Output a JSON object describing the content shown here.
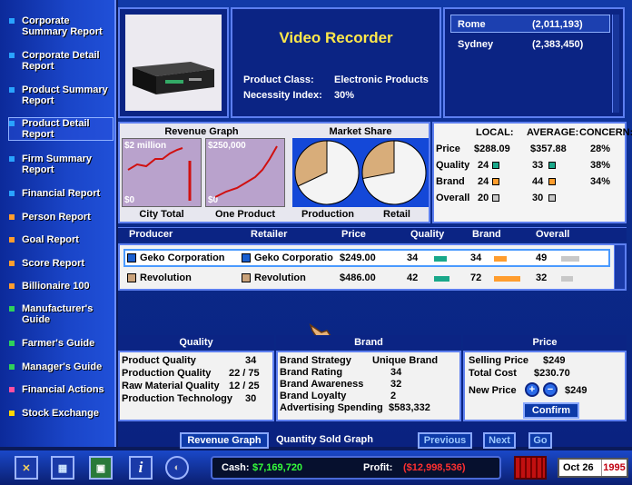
{
  "sidebar": {
    "items": [
      {
        "label": "Corporate Summary Report",
        "color": "#29a3ff"
      },
      {
        "label": "Corporate Detail Report",
        "color": "#29a3ff"
      },
      {
        "label": "Product Summary Report",
        "color": "#29a3ff"
      },
      {
        "label": "Product Detail Report",
        "color": "#29a3ff"
      },
      {
        "label": "Firm Summary Report",
        "color": "#29a3ff"
      },
      {
        "label": "Financial Report",
        "color": "#29a3ff"
      },
      {
        "label": "Person Report",
        "color": "#ff9d2e"
      },
      {
        "label": "Goal Report",
        "color": "#ff9d2e"
      },
      {
        "label": "Score Report",
        "color": "#ff9d2e"
      },
      {
        "label": "Billionaire 100",
        "color": "#ff9d2e"
      },
      {
        "label": "Manufacturer's Guide",
        "color": "#2fd15a"
      },
      {
        "label": "Farmer's Guide",
        "color": "#2fd15a"
      },
      {
        "label": "Manager's Guide",
        "color": "#2fd15a"
      },
      {
        "label": "Financial Actions",
        "color": "#ff4fa0"
      },
      {
        "label": "Stock Exchange",
        "color": "#ffd700"
      }
    ]
  },
  "product": {
    "name": "Video Recorder",
    "class_label": "Product Class:",
    "class_value": "Electronic Products",
    "necessity_label": "Necessity Index:",
    "necessity_value": "30%"
  },
  "cities": [
    {
      "name": "Rome",
      "pop": "(2,011,193)"
    },
    {
      "name": "Sydney",
      "pop": "(2,383,450)"
    }
  ],
  "revenue_graph": {
    "title": "Revenue Graph",
    "city_total": {
      "label": "City Total",
      "top": "$2 million",
      "bottom": "$0"
    },
    "one_product": {
      "label": "One Product",
      "top": "$250,000",
      "bottom": "$0"
    }
  },
  "market_share": {
    "title": "Market Share",
    "production_label": "Production",
    "retail_label": "Retail",
    "production_share": 0.32,
    "retail_share": 0.28
  },
  "local_stats": {
    "headers": [
      "LOCAL:",
      "AVERAGE:",
      "CONCERN:"
    ],
    "rows": [
      {
        "label": "Price",
        "local": "$288.09",
        "average": "$357.88",
        "concern": "28%"
      },
      {
        "label": "Quality",
        "local": "24",
        "average": "33",
        "concern": "38%",
        "color": "#1aa88a"
      },
      {
        "label": "Brand",
        "local": "24",
        "average": "44",
        "concern": "34%",
        "color": "#ff9d2e"
      },
      {
        "label": "Overall",
        "local": "20",
        "average": "30",
        "concern": "",
        "color": "#c8c8c8"
      }
    ]
  },
  "competitors": {
    "headers": [
      "Producer",
      "Retailer",
      "Price",
      "Quality",
      "Brand",
      "Overall"
    ],
    "rows": [
      {
        "producer": "Geko Corporation",
        "retailer": "Geko Corporatio",
        "price": "$249.00",
        "quality": "34",
        "brand": "34",
        "overall": "49",
        "producer_color": "#1a5fd0",
        "retailer_color": "#1a5fd0",
        "quality_level": 0.34,
        "brand_level": 0.34,
        "overall_level": 0.49
      },
      {
        "producer": "Revolution",
        "retailer": "Revolution",
        "price": "$486.00",
        "quality": "42",
        "brand": "72",
        "overall": "32",
        "producer_color": "#c9a27a",
        "retailer_color": "#c9a27a",
        "quality_level": 0.42,
        "brand_level": 0.72,
        "overall_level": 0.32
      }
    ]
  },
  "quality_panel": {
    "title": "Quality",
    "rows": [
      {
        "label": "Product Quality",
        "value": "34"
      },
      {
        "label": "Production Quality",
        "value": "22 / 75"
      },
      {
        "label": "Raw Material Quality",
        "value": "12 / 25"
      },
      {
        "label": "Production Technology",
        "value": "30"
      }
    ]
  },
  "brand_panel": {
    "title": "Brand",
    "rows": [
      {
        "label": "Brand Strategy",
        "value": "Unique Brand"
      },
      {
        "label": "Brand Rating",
        "value": "34"
      },
      {
        "label": "Brand Awareness",
        "value": "32"
      },
      {
        "label": "Brand Loyalty",
        "value": "2"
      },
      {
        "label": "Advertising Spending",
        "value": "$583,332"
      }
    ]
  },
  "price_panel": {
    "title": "Price",
    "selling_label": "Selling Price",
    "selling_value": "$249",
    "cost_label": "Total Cost",
    "cost_value": "$230.70",
    "new_price_label": "New Price",
    "new_price_value": "$249",
    "confirm_label": "Confirm"
  },
  "bottom_nav": {
    "revenue_graph": "Revenue Graph",
    "quantity_sold": "Quantity Sold Graph",
    "previous": "Previous",
    "next": "Next",
    "go": "Go"
  },
  "status_bar": {
    "cash_label": "Cash:",
    "cash_value": "$7,169,720",
    "profit_label": "Profit:",
    "profit_value": "($12,998,536)",
    "date": "Oct 26",
    "year": "1995",
    "cash_color": "#35ff3a",
    "profit_color": "#ff3030"
  }
}
